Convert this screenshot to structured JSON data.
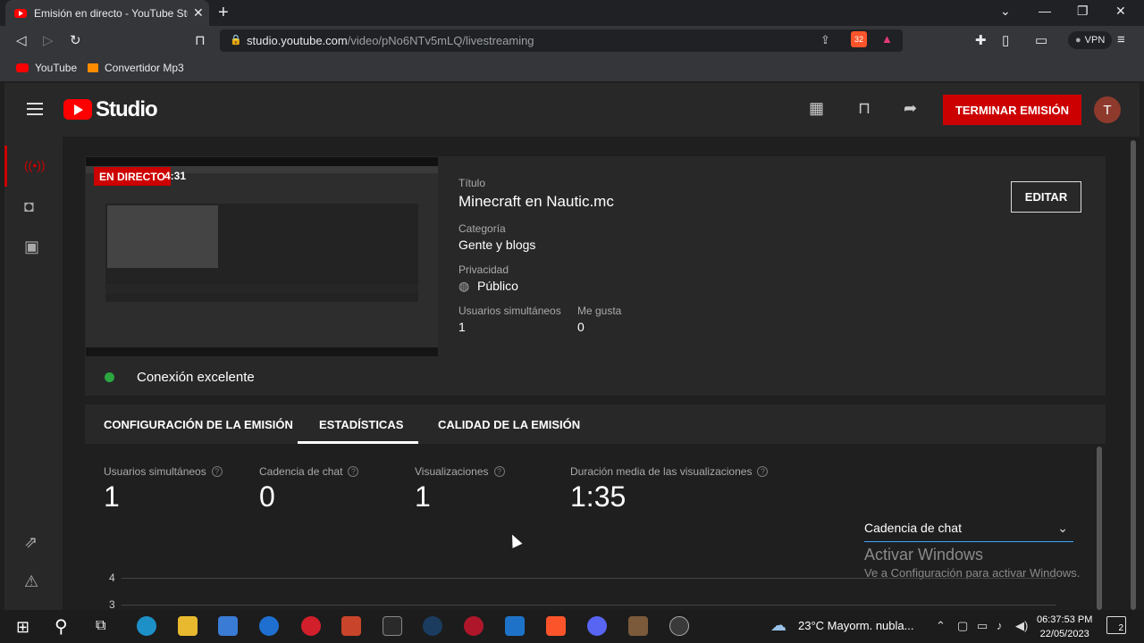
{
  "browser": {
    "tab_title": "Emisión en directo - YouTube Studio",
    "url_host": "studio.youtube.com",
    "url_path": "/video/pNo6NTv5mLQ/livestreaming",
    "vpn_label": "VPN",
    "brave_badge": "32",
    "bookmarks": [
      {
        "label": "YouTube",
        "color": "#ff0000"
      },
      {
        "label": "Convertidor Mp3",
        "color": "#ff8c00"
      }
    ]
  },
  "studio": {
    "logo_text": "Studio",
    "end_button": "TERMINAR EMISIÓN",
    "avatar_letter": "T",
    "accent": "#cc0000"
  },
  "stream": {
    "live_badge": "EN DIRECTO",
    "live_time": "4:31",
    "connection": "Conexión excelente",
    "title_label": "Título",
    "title": "Minecraft en Nautic.mc",
    "category_label": "Categoría",
    "category": "Gente y blogs",
    "privacy_label": "Privacidad",
    "privacy": "Público",
    "viewers_label": "Usuarios simultáneos",
    "viewers": "1",
    "likes_label": "Me gusta",
    "likes": "0",
    "edit_button": "EDITAR"
  },
  "tabs": [
    {
      "label": "CONFIGURACIÓN DE LA EMISIÓN"
    },
    {
      "label": "ESTADÍSTICAS"
    },
    {
      "label": "CALIDAD DE LA EMISIÓN"
    }
  ],
  "stats": [
    {
      "label": "Usuarios simultáneos",
      "value": "1"
    },
    {
      "label": "Cadencia de chat",
      "value": "0"
    },
    {
      "label": "Visualizaciones",
      "value": "1"
    },
    {
      "label": "Duración media de las visualizaciones",
      "value": "1:35"
    }
  ],
  "help_glyph": "?",
  "chart_select": "Cadencia de chat",
  "chart_ticks": [
    "4",
    "3"
  ],
  "activation": {
    "title": "Activar Windows",
    "subtitle": "Ve a Configuración para activar Windows."
  },
  "taskbar": {
    "weather": "23°C  Mayorm. nubla...",
    "time": "06:37:53 PM",
    "date": "22/05/2023",
    "notifications": "2"
  }
}
